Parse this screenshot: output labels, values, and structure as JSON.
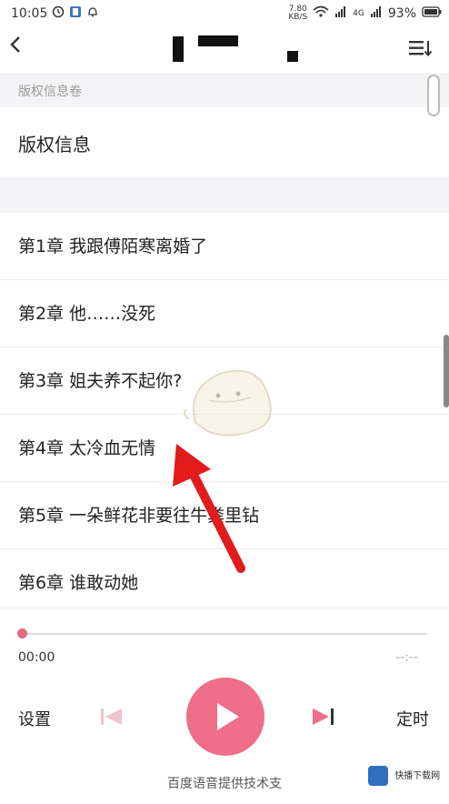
{
  "status_bar": {
    "time": "10:05",
    "network_speed_value": "7.80",
    "network_speed_unit": "KB/S",
    "signal_label": "4G",
    "battery": "93%"
  },
  "section_label": "版权信息卷",
  "copyright_item": "版权信息",
  "chapters": [
    "第1章 我跟傅陌寒离婚了",
    "第2章 他……没死",
    "第3章 姐夫养不起你?",
    "第4章 太冷血无情",
    "第5章 一朵鲜花非要往牛粪里钻",
    "第6章 谁敢动她"
  ],
  "player": {
    "current_time": "00:00",
    "total_time": "--:--",
    "progress": 0,
    "settings_label": "设置",
    "timer_label": "定时",
    "credit": "百度语音提供技术支"
  },
  "watermark": "快播下载网",
  "colors": {
    "accent": "#ef6e89",
    "arrow": "#e21b1b"
  }
}
